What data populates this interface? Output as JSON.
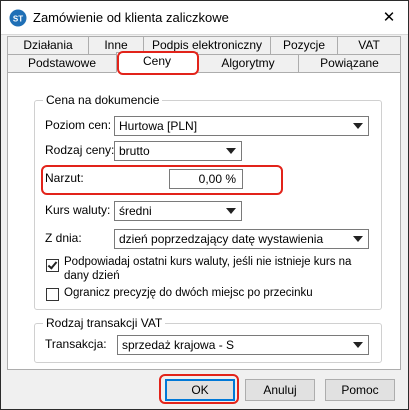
{
  "window": {
    "title": "Zamówienie od klienta zaliczkowe",
    "close_glyph": "✕"
  },
  "tabs": {
    "row1": [
      "Działania",
      "Inne",
      "Podpis elektroniczny",
      "Pozycje",
      "VAT"
    ],
    "row2": [
      "Podstawowe",
      "Ceny",
      "Algorytmy",
      "Powiązane"
    ],
    "active": "Ceny"
  },
  "price_group": {
    "title": "Cena na dokumencie",
    "price_level": {
      "label": "Poziom cen:",
      "value": "Hurtowa [PLN]"
    },
    "price_type": {
      "label": "Rodzaj ceny:",
      "value": "brutto"
    },
    "markup": {
      "label": "Narzut:",
      "value": "0,00 %"
    },
    "exchange_rate": {
      "label": "Kurs waluty:",
      "value": "średni"
    },
    "from_day": {
      "label": "Z dnia:",
      "value": "dzień poprzedzający datę wystawienia"
    },
    "suggest_rate": {
      "label_line1": "Podpowiadaj ostatni kurs waluty, jeśli nie istnieje kurs na",
      "label_line2": "dany dzień",
      "checked": true
    },
    "limit_precision": {
      "label": "Ogranicz precyzję do dwóch miejsc po przecinku",
      "checked": false
    }
  },
  "vat_group": {
    "title": "Rodzaj transakcji VAT",
    "transaction": {
      "label": "Transakcja:",
      "value": "sprzedaż krajowa - S"
    }
  },
  "buttons": {
    "ok": "OK",
    "cancel": "Anuluj",
    "help": "Pomoc"
  },
  "colors": {
    "highlight": "#e2231a",
    "focus": "#0078d7"
  }
}
